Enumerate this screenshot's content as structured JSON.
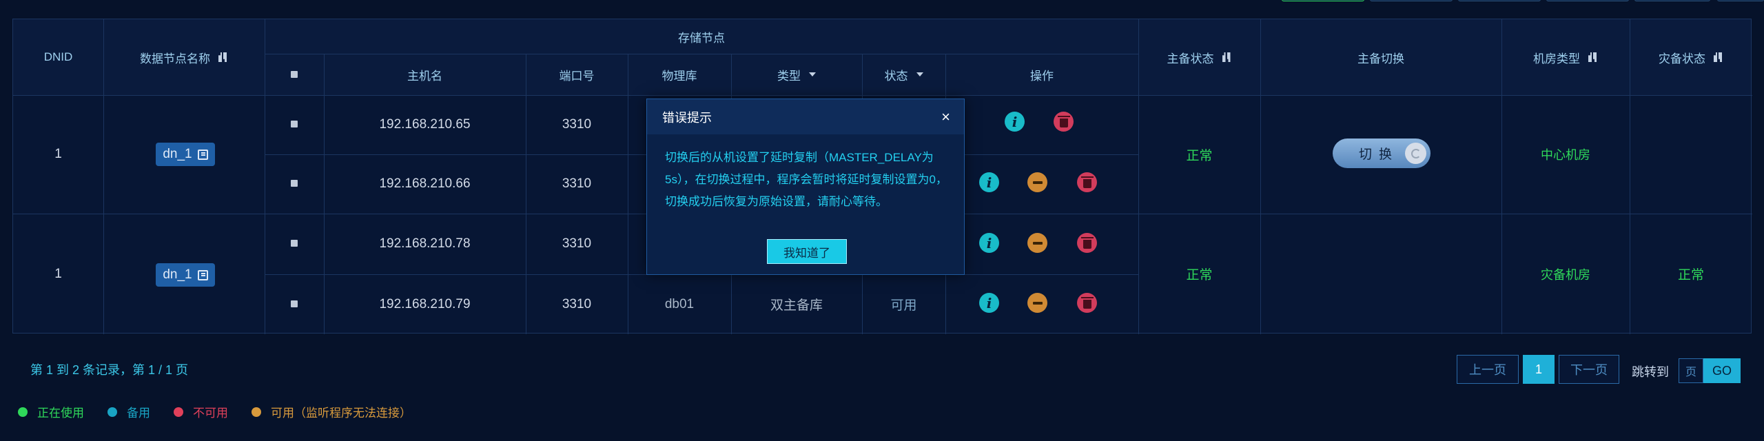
{
  "table": {
    "headers": {
      "dnid": "DNID",
      "node_name": "数据节点名称",
      "storage_group": "存储节点",
      "hostname": "主机名",
      "port": "端口号",
      "physical_db": "物理库",
      "type": "类型",
      "status": "状态",
      "actions": "操作",
      "master_standby_status": "主备状态",
      "master_standby_switch": "主备切换",
      "room_type": "机房类型",
      "disaster_status": "灾备状态"
    },
    "groups": [
      {
        "dnid": "1",
        "node_name": "dn_1",
        "master_standby_status": "正常",
        "switch_label": "切换",
        "room_type": "中心机房",
        "disaster_status": "",
        "rows": [
          {
            "host": "192.168.210.65",
            "port": "3310",
            "db": "",
            "type": "",
            "status": ""
          },
          {
            "host": "192.168.210.66",
            "port": "3310",
            "db": "",
            "type": "",
            "status": ""
          }
        ]
      },
      {
        "dnid": "1",
        "node_name": "dn_1",
        "master_standby_status": "正常",
        "switch_label": "",
        "room_type": "灾备机房",
        "disaster_status": "正常",
        "rows": [
          {
            "host": "192.168.210.78",
            "port": "3310",
            "db": "",
            "type": "",
            "status": ""
          },
          {
            "host": "192.168.210.79",
            "port": "3310",
            "db": "db01",
            "type": "双主备库",
            "status": "可用"
          }
        ]
      }
    ]
  },
  "modal": {
    "title": "错误提示",
    "message": "切换后的从机设置了延时复制（MASTER_DELAY为5s），在切换过程中，程序会暂时将延时复制设置为0，切换成功后恢复为原始设置，请耐心等待。",
    "confirm": "我知道了"
  },
  "footer": {
    "summary": "第 1 到 2 条记录，第 1 / 1 页",
    "prev": "上一页",
    "current_page": "1",
    "next": "下一页",
    "jump_label": "跳转到",
    "jump_placeholder": "页",
    "go": "GO"
  },
  "legend": [
    {
      "label": "正在使用",
      "color": "#2fd85a"
    },
    {
      "label": "备用",
      "color": "#19a4c4"
    },
    {
      "label": "不可用",
      "color": "#e0405a"
    },
    {
      "label": "可用（监听程序无法连接）",
      "color": "#d89a3c"
    }
  ],
  "icons": {
    "info": "i",
    "close": "×"
  }
}
